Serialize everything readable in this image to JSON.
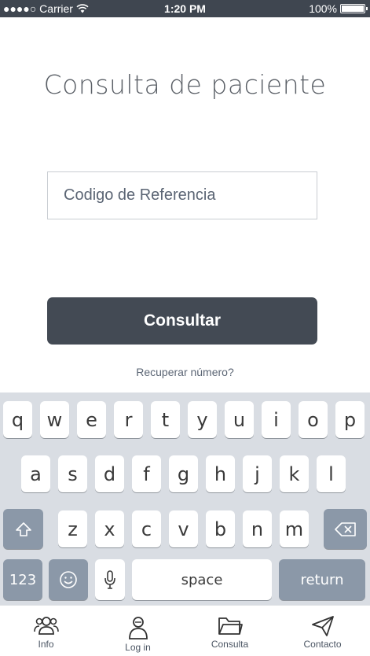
{
  "status_bar": {
    "carrier": "●●●●○ Carrier",
    "time": "1:20 PM",
    "battery": "100%"
  },
  "page": {
    "title": "Consulta de paciente",
    "input_placeholder": "Codigo de Referencia",
    "consult_button": "Consultar",
    "recover_link": "Recuperar número?"
  },
  "keyboard": {
    "row1": [
      "q",
      "w",
      "e",
      "r",
      "t",
      "y",
      "u",
      "i",
      "o",
      "p"
    ],
    "row2": [
      "a",
      "s",
      "d",
      "f",
      "g",
      "h",
      "j",
      "k",
      "l"
    ],
    "row3": [
      "z",
      "x",
      "c",
      "v",
      "b",
      "n",
      "m"
    ],
    "numbers_key": "123",
    "space_key": "space",
    "return_key": "return"
  },
  "tabbar": {
    "tabs": [
      {
        "label": "Info",
        "icon": "users-icon"
      },
      {
        "label": "Log in",
        "icon": "user-login-icon"
      },
      {
        "label": "Consulta",
        "icon": "folder-icon"
      },
      {
        "label": "Contacto",
        "icon": "send-icon"
      }
    ]
  }
}
